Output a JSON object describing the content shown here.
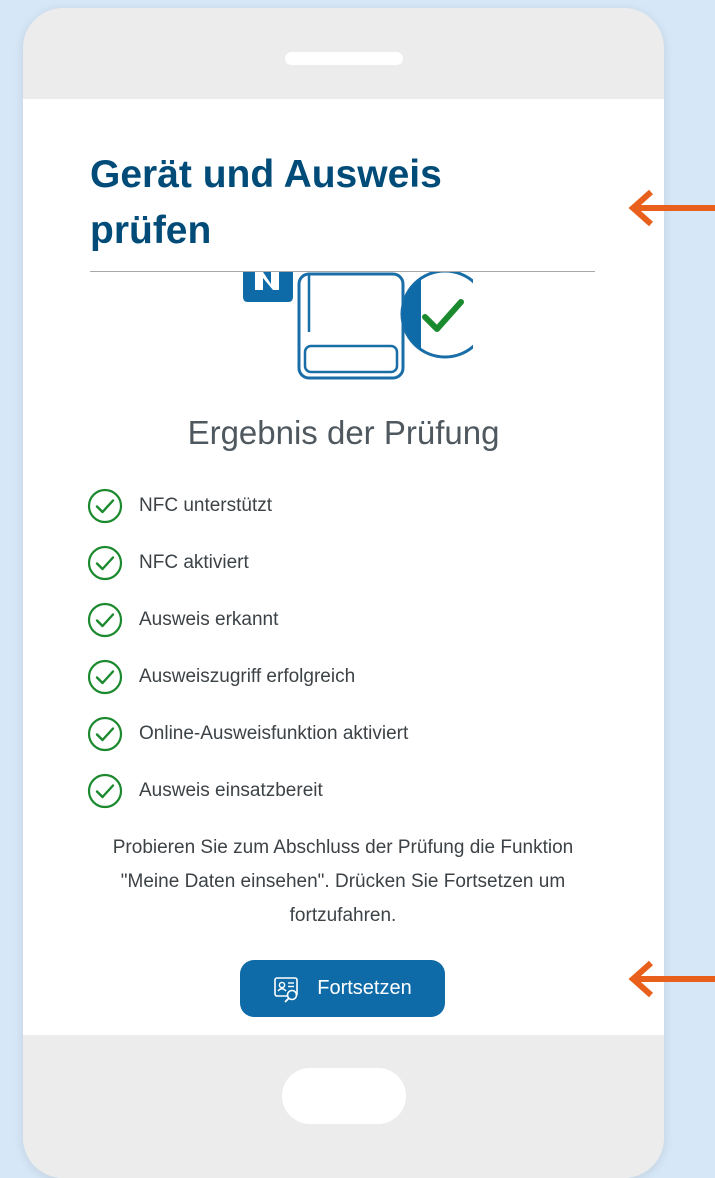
{
  "header": {
    "title": "Gerät und Ausweis prüfen"
  },
  "result": {
    "heading": "Ergebnis der Prüfung",
    "checks": [
      {
        "label": "NFC unterstützt",
        "status": "success"
      },
      {
        "label": "NFC aktiviert",
        "status": "success"
      },
      {
        "label": "Ausweis erkannt",
        "status": "success"
      },
      {
        "label": "Ausweiszugriff erfolgreich",
        "status": "success"
      },
      {
        "label": "Online-Ausweisfunktion aktiviert",
        "status": "success"
      },
      {
        "label": "Ausweis einsatzbereit",
        "status": "success"
      }
    ]
  },
  "info": {
    "text": "Probieren Sie zum Abschluss der Prüfung die Funktion \"Meine Daten einsehen\". Drücken Sie Fortsetzen um fortzufahren."
  },
  "actions": {
    "continue_label": "Fortsetzen",
    "continue_icon": "id-card-search-icon"
  },
  "colors": {
    "title": "#004b78",
    "success": "#1b8a2e",
    "button": "#0f6ba8",
    "annotation_arrow": "#e8601c",
    "background": "#d6e7f7"
  }
}
